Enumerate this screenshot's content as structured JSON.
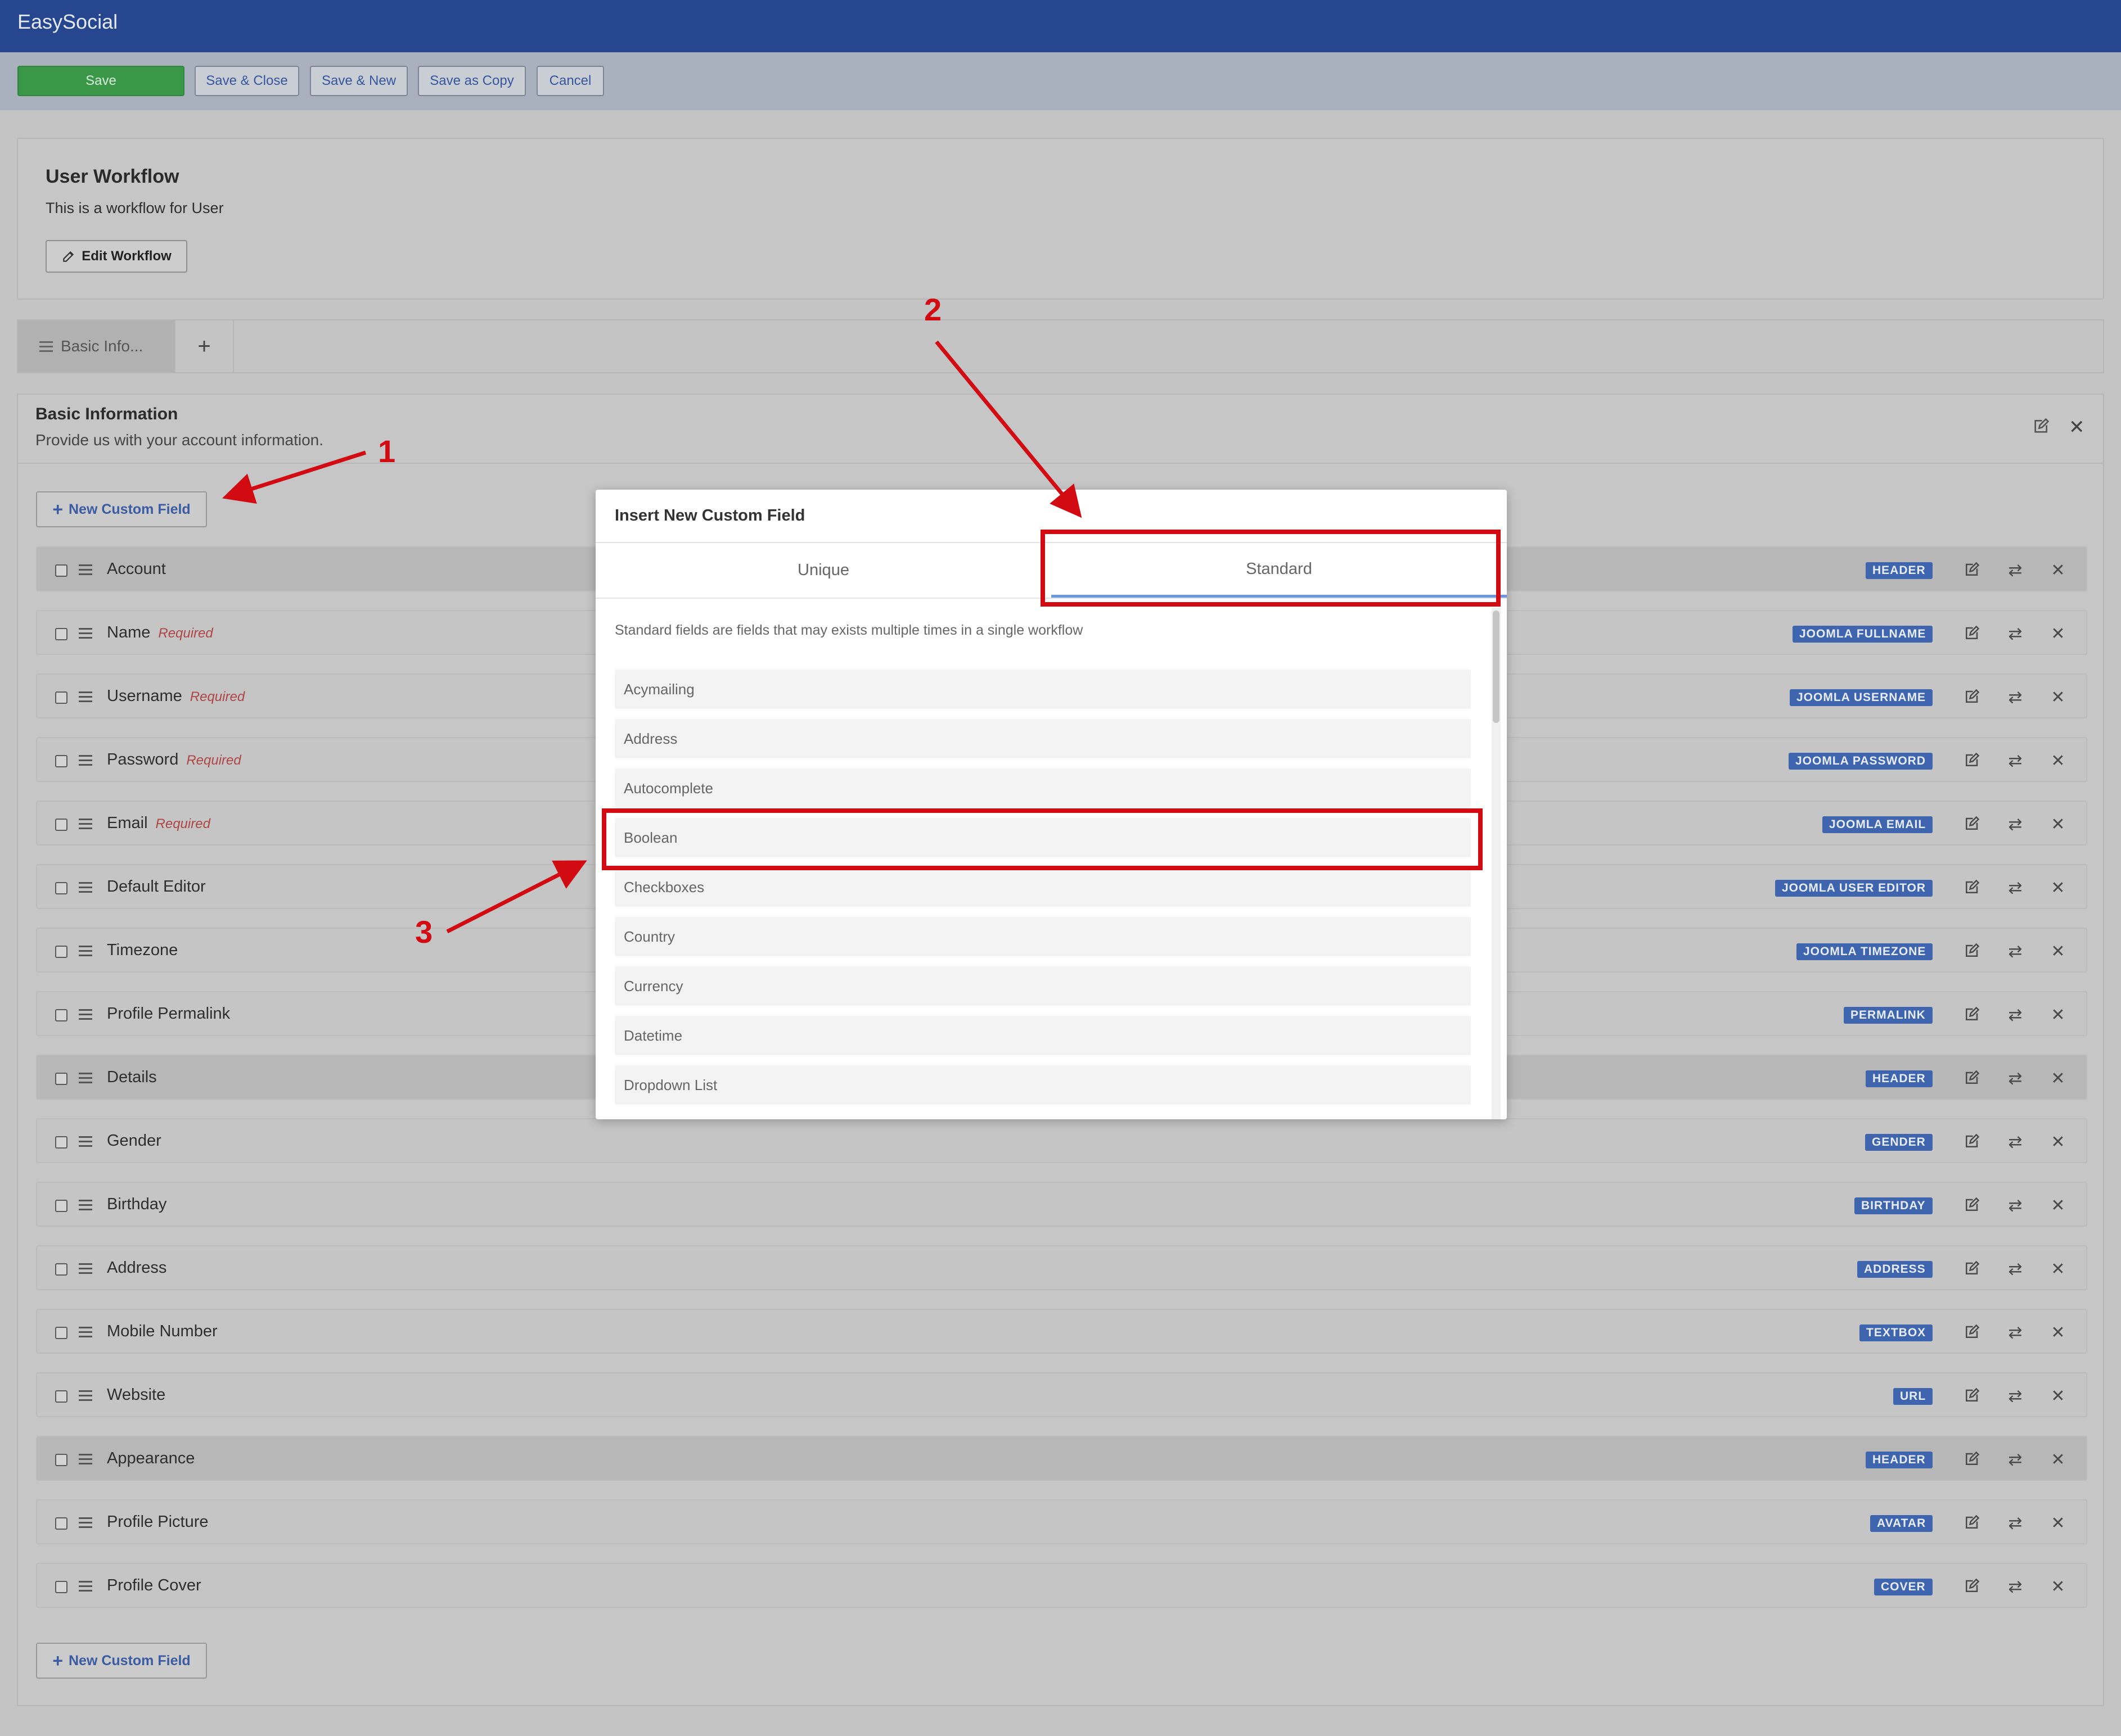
{
  "app": {
    "title": "EasySocial"
  },
  "toolbar": {
    "save": "Save",
    "save_close": "Save & Close",
    "save_new": "Save & New",
    "save_copy": "Save as Copy",
    "cancel": "Cancel"
  },
  "workflow": {
    "title": "User Workflow",
    "description": "This is a workflow for User",
    "edit_button": "Edit Workflow"
  },
  "tabs": {
    "first": "Basic Info...",
    "add": "+"
  },
  "section": {
    "title": "Basic Information",
    "description": "Provide us with your account information.",
    "new_field_button": "New Custom Field"
  },
  "fields": [
    {
      "name": "Account",
      "required": "",
      "badge": "HEADER",
      "header": true
    },
    {
      "name": "Name",
      "required": "Required",
      "badge": "JOOMLA FULLNAME",
      "header": false
    },
    {
      "name": "Username",
      "required": "Required",
      "badge": "JOOMLA USERNAME",
      "header": false
    },
    {
      "name": "Password",
      "required": "Required",
      "badge": "JOOMLA PASSWORD",
      "header": false
    },
    {
      "name": "Email",
      "required": "Required",
      "badge": "JOOMLA EMAIL",
      "header": false
    },
    {
      "name": "Default Editor",
      "required": "",
      "badge": "JOOMLA USER EDITOR",
      "header": false
    },
    {
      "name": "Timezone",
      "required": "",
      "badge": "JOOMLA TIMEZONE",
      "header": false
    },
    {
      "name": "Profile Permalink",
      "required": "",
      "badge": "PERMALINK",
      "header": false
    },
    {
      "name": "Details",
      "required": "",
      "badge": "HEADER",
      "header": true
    },
    {
      "name": "Gender",
      "required": "",
      "badge": "GENDER",
      "header": false
    },
    {
      "name": "Birthday",
      "required": "",
      "badge": "BIRTHDAY",
      "header": false
    },
    {
      "name": "Address",
      "required": "",
      "badge": "ADDRESS",
      "header": false
    },
    {
      "name": "Mobile Number",
      "required": "",
      "badge": "TEXTBOX",
      "header": false
    },
    {
      "name": "Website",
      "required": "",
      "badge": "URL",
      "header": false
    },
    {
      "name": "Appearance",
      "required": "",
      "badge": "HEADER",
      "header": true
    },
    {
      "name": "Profile Picture",
      "required": "",
      "badge": "AVATAR",
      "header": false
    },
    {
      "name": "Profile Cover",
      "required": "",
      "badge": "COVER",
      "header": false
    }
  ],
  "modal": {
    "title": "Insert New Custom Field",
    "tab_unique": "Unique",
    "tab_standard": "Standard",
    "description": "Standard fields are fields that may exists multiple times in a single workflow",
    "options": [
      "Acymailing",
      "Address",
      "Autocomplete",
      "Boolean",
      "Checkboxes",
      "Country",
      "Currency",
      "Datetime",
      "Dropdown List"
    ]
  },
  "annotations": {
    "one": "1",
    "two": "2",
    "three": "3",
    "color": "#d20a12"
  },
  "icons": {
    "edit": "edit-icon",
    "move": "swap-icon",
    "delete": "close-icon",
    "drag": "drag-handle-icon"
  }
}
